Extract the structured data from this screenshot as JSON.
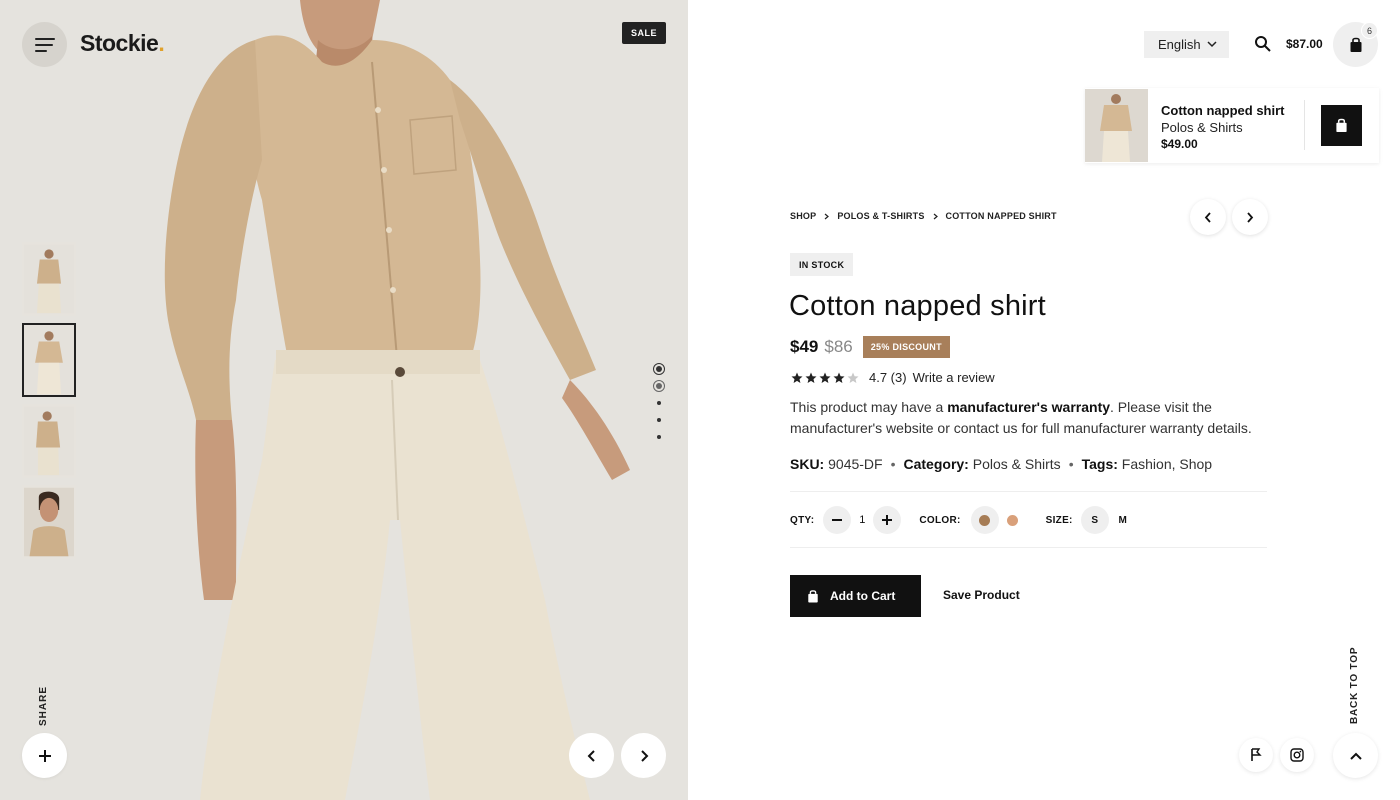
{
  "brand": {
    "name": "Stockie",
    "dot": "."
  },
  "gallery": {
    "sale_badge": "SALE",
    "thumbnails": [
      "thumb-front",
      "thumb-pose",
      "thumb-side",
      "thumb-portrait"
    ],
    "active_thumbnail": 1,
    "share_label": "SHARE"
  },
  "header": {
    "language": "English",
    "cart_total": "$87.00",
    "cart_count": "6"
  },
  "mini_product": {
    "name": "Cotton napped shirt",
    "category": "Polos & Shirts",
    "price": "$49.00"
  },
  "breadcrumb": [
    "SHOP",
    "POLOS & T-SHIRTS",
    "COTTON NAPPED SHIRT"
  ],
  "product": {
    "stock": "IN STOCK",
    "title": "Cotton napped shirt",
    "price": "$49",
    "old_price": "$86",
    "discount": "25% DISCOUNT",
    "rating": 4,
    "rating_text": "4.7 (3)",
    "review_link": "Write a review",
    "desc_part1": "This product may have a ",
    "desc_bold": "manufacturer's warranty",
    "desc_part2": ". Please visit the manufacturer's website or contact us for full manufacturer warranty details.",
    "sku_label": "SKU:",
    "sku": "9045-DF",
    "category_label": "Category:",
    "category": "Polos & Shirts",
    "tags_label": "Tags:",
    "tags": "Fashion, Shop"
  },
  "options": {
    "qty_label": "QTY:",
    "qty": "1",
    "color_label": "COLOR:",
    "colors": [
      "#a67c55",
      "#d9a07a"
    ],
    "size_label": "SIZE:",
    "sizes": [
      "S",
      "M"
    ]
  },
  "actions": {
    "add_to_cart": "Add to Cart",
    "save_product": "Save Product",
    "back_to_top": "BACK TO TOP"
  },
  "colors": {
    "accent_logo_dot": "#e0a12b",
    "discount_bg": "#a87f5a",
    "button_dark": "#111111"
  }
}
